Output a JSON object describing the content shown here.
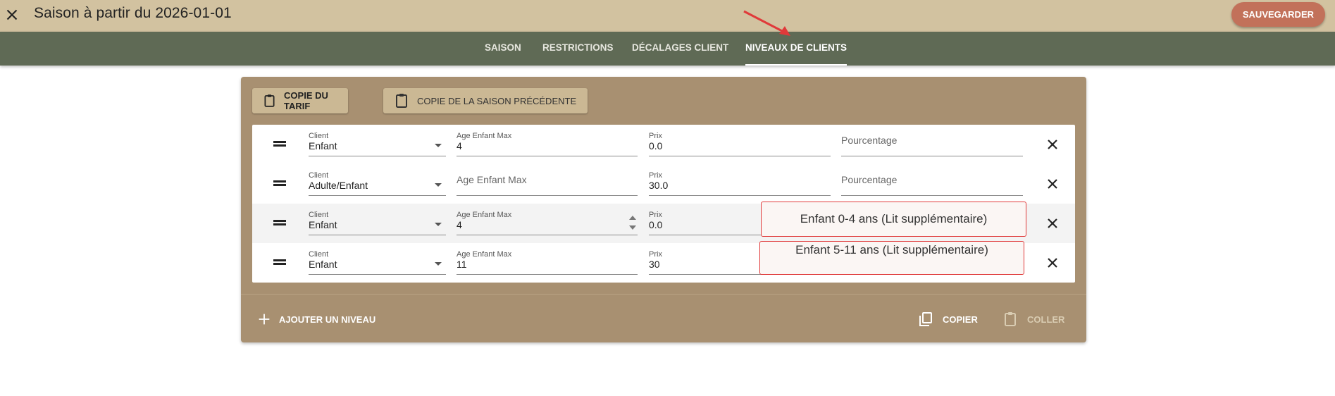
{
  "header": {
    "title": "Saison à partir du 2026-01-01",
    "save_label": "SAUVEGARDER"
  },
  "tabs": [
    {
      "label": "SAISON"
    },
    {
      "label": "RESTRICTIONS"
    },
    {
      "label": "DÉCALAGES CLIENT"
    },
    {
      "label": "NIVEAUX DE CLIENTS",
      "active": true
    }
  ],
  "toolbar": {
    "copy_tariff_label": "COPIE DU TARIF",
    "copy_prev_season_label": "COPIE DE LA SAISON PRÉCÉDENTE"
  },
  "rows": [
    {
      "client_label": "Client",
      "client_value": "Enfant",
      "age_label": "Age Enfant Max",
      "age_value": "4",
      "price_label": "Prix",
      "price_value": "0.0",
      "percent_placeholder": "Pourcentage"
    },
    {
      "client_label": "Client",
      "client_value": "Adulte/Enfant",
      "age_placeholder": "Age Enfant Max",
      "price_label": "Prix",
      "price_value": "30.0",
      "percent_placeholder": "Pourcentage"
    },
    {
      "client_label": "Client",
      "client_value": "Enfant",
      "age_label": "Age Enfant Max",
      "age_value": "4",
      "price_label": "Prix",
      "price_value": "0.0"
    },
    {
      "client_label": "Client",
      "client_value": "Enfant",
      "age_label": "Age Enfant Max",
      "age_value": "11",
      "price_label": "Prix",
      "price_value": "30"
    }
  ],
  "footer": {
    "add_level_label": "AJOUTER UN NIVEAU",
    "copy_label": "COPIER",
    "paste_label": "COLLER"
  },
  "annotations": {
    "note1": "Enfant 0-4 ans  (Lit supplémentaire)",
    "note2": "Enfant 5-11 ans  (Lit supplémentaire)"
  },
  "colors": {
    "header_bg": "#d2c2a0",
    "tabbar_bg": "#5f6a55",
    "panel_bg": "#a89071",
    "save_button": "#c2715a",
    "annotation_red": "#e03a3a"
  },
  "icons": {
    "close": "close-icon",
    "clipboard": "clipboard-icon",
    "drag": "drag-handle-icon",
    "delete": "close-icon",
    "add": "plus-icon",
    "copy": "copy-icon",
    "paste": "paste-icon"
  }
}
